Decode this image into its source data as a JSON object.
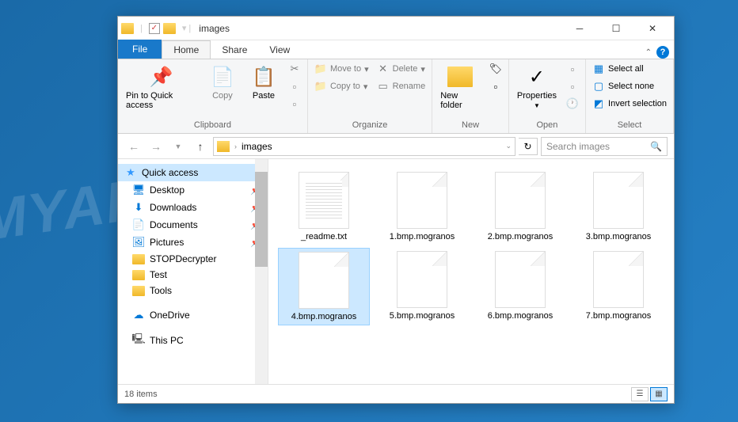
{
  "titlebar": {
    "title": "images"
  },
  "tabs": {
    "file": "File",
    "home": "Home",
    "share": "Share",
    "view": "View"
  },
  "ribbon": {
    "clipboard": {
      "label": "Clipboard",
      "pin": "Pin to Quick access",
      "copy": "Copy",
      "paste": "Paste"
    },
    "organize": {
      "label": "Organize",
      "moveto": "Move to",
      "copyto": "Copy to",
      "delete": "Delete",
      "rename": "Rename"
    },
    "new": {
      "label": "New",
      "newfolder": "New folder"
    },
    "open": {
      "label": "Open",
      "properties": "Properties"
    },
    "select": {
      "label": "Select",
      "selectall": "Select all",
      "selectnone": "Select none",
      "invert": "Invert selection"
    }
  },
  "address": {
    "path": "images"
  },
  "search": {
    "placeholder": "Search images"
  },
  "sidebar": {
    "items": [
      {
        "label": "Quick access",
        "type": "quickaccess"
      },
      {
        "label": "Desktop",
        "type": "desktop",
        "pinned": true
      },
      {
        "label": "Downloads",
        "type": "downloads",
        "pinned": true
      },
      {
        "label": "Documents",
        "type": "documents",
        "pinned": true
      },
      {
        "label": "Pictures",
        "type": "pictures",
        "pinned": true
      },
      {
        "label": "STOPDecrypter",
        "type": "folder"
      },
      {
        "label": "Test",
        "type": "folder"
      },
      {
        "label": "Tools",
        "type": "folder"
      },
      {
        "label": "OneDrive",
        "type": "onedrive"
      },
      {
        "label": "This PC",
        "type": "thispc"
      }
    ]
  },
  "files": [
    {
      "name": "_readme.txt",
      "type": "txt"
    },
    {
      "name": "1.bmp.mogranos",
      "type": "file"
    },
    {
      "name": "2.bmp.mogranos",
      "type": "file"
    },
    {
      "name": "3.bmp.mogranos",
      "type": "file"
    },
    {
      "name": "4.bmp.mogranos",
      "type": "file",
      "selected": true
    },
    {
      "name": "5.bmp.mogranos",
      "type": "file"
    },
    {
      "name": "6.bmp.mogranos",
      "type": "file"
    },
    {
      "name": "7.bmp.mogranos",
      "type": "file"
    }
  ],
  "statusbar": {
    "count": "18 items"
  },
  "watermark": "MYANTISPYWARE.COM"
}
